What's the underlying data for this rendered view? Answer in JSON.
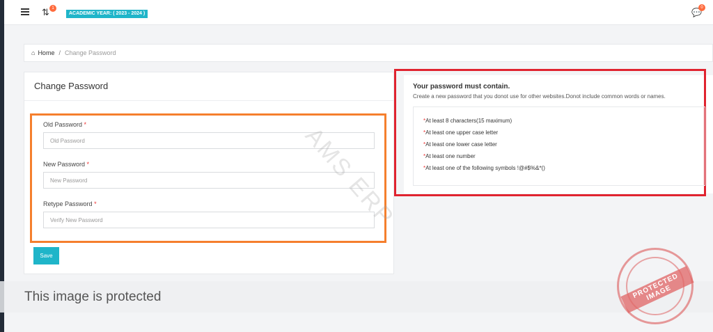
{
  "topbar": {
    "notification_count": "1",
    "academic_year": "ACADEMIC YEAR: ( 2023 - 2024 )",
    "chat_count": "0"
  },
  "breadcrumb": {
    "home": "Home",
    "separator": "/",
    "current": "Change Password"
  },
  "form": {
    "title": "Change Password",
    "old_password": {
      "label": "Old Password",
      "placeholder": "Old Password",
      "value": ""
    },
    "new_password": {
      "label": "New Password",
      "placeholder": "New Password",
      "value": ""
    },
    "retype_password": {
      "label": "Retype Password",
      "placeholder": "Verify New Password",
      "value": ""
    },
    "required_mark": "*",
    "save_label": "Save"
  },
  "rules": {
    "title": "Your password must contain.",
    "subtitle": "Create a new password that you donot use for other websites.Donot include common words or names.",
    "items": [
      "At least 8 characters(15 maximum)",
      "At least one upper case letter",
      "At least one lower case letter",
      "At least one number",
      "At least one of the following symbols !@#$%&*()"
    ]
  },
  "watermark": "AMS ERP",
  "protected_notice": "This image is protected",
  "stamp": "PROTECTED IMAGE",
  "colors": {
    "accent": "#1fb5c9",
    "badge": "#ff6b3d",
    "form_highlight": "#f57f2d",
    "rules_highlight": "#e0232f",
    "sidebar": "#232c38"
  }
}
